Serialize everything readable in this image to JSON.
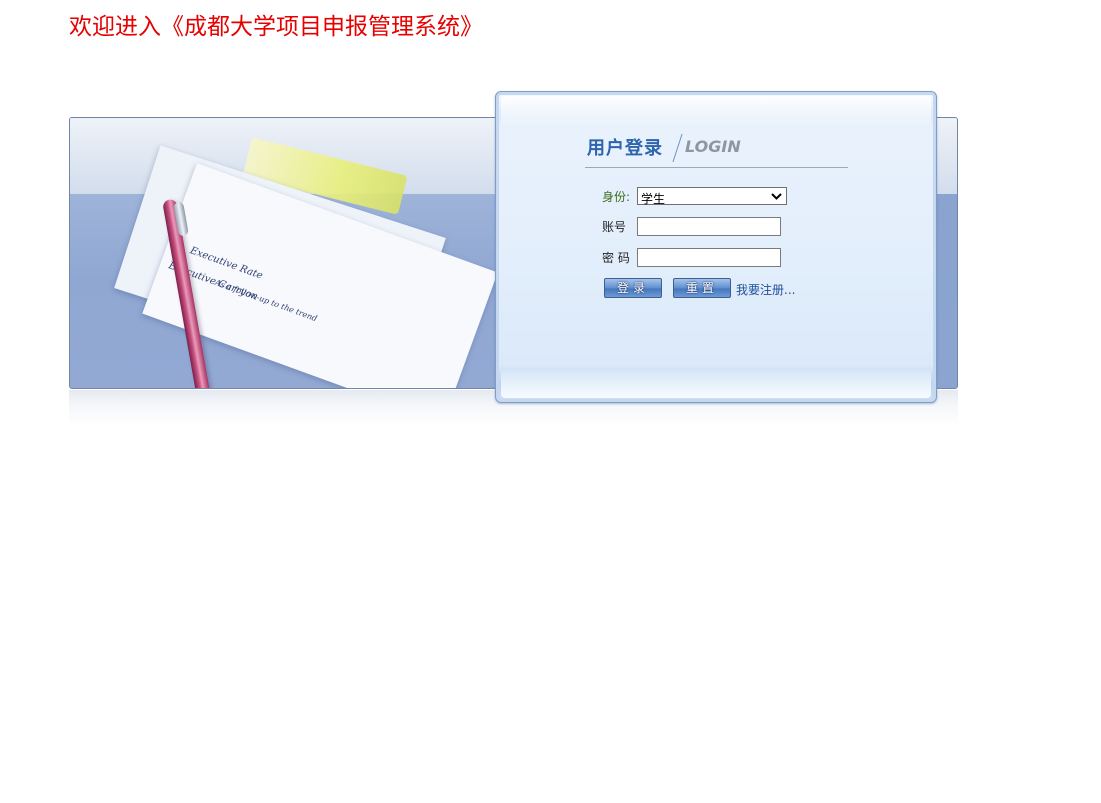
{
  "header": {
    "welcome_text": "欢迎进入《成都大学项目申报管理系统》"
  },
  "banner": {
    "paper_text_1": "Executive Rate",
    "paper_text_2": "Executive Carryon",
    "paper_text_3": "As a follow-up to the trend"
  },
  "login": {
    "title": "用户登录",
    "subtitle": "LOGIN",
    "identity_label": "身份:",
    "identity_value": "学生",
    "account_label": "账号",
    "account_value": "",
    "password_label": "密 码",
    "password_value": "",
    "login_button": "登录",
    "reset_button": "重置",
    "register_link": "我要注册..."
  },
  "colors": {
    "welcome": "#e60000",
    "title": "#2e64ad",
    "identity_label": "#3d6b1e"
  }
}
